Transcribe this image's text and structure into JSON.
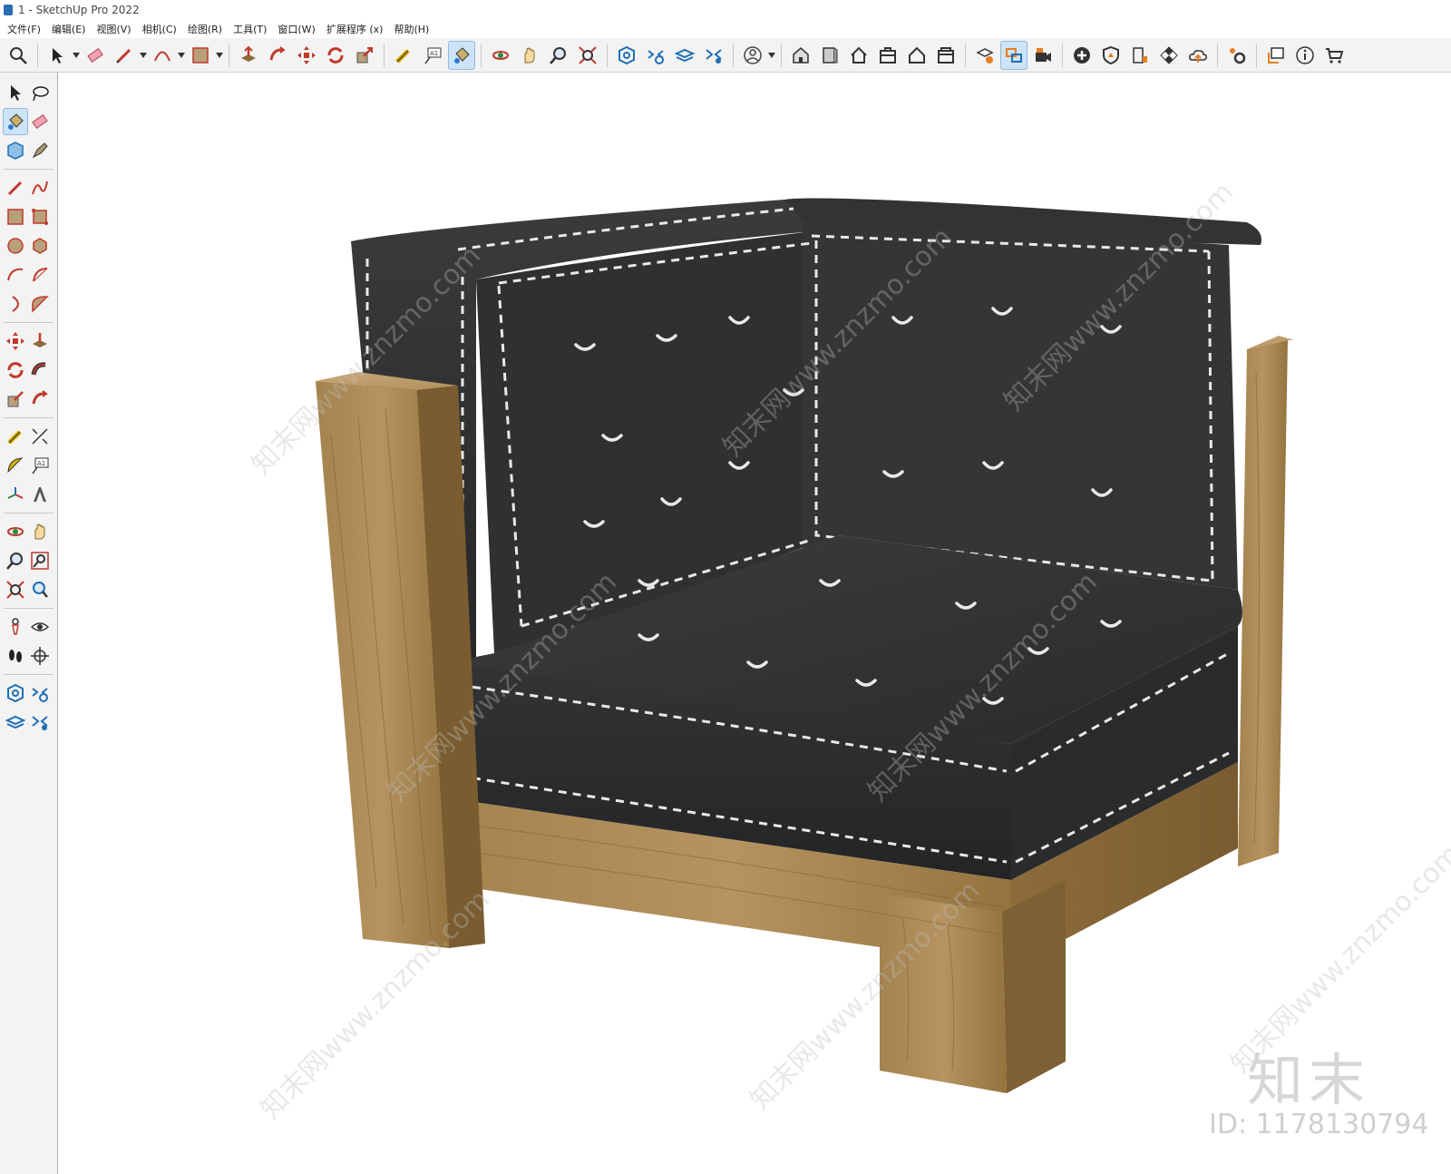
{
  "window": {
    "title": "1 - SketchUp Pro 2022"
  },
  "menu": [
    {
      "id": "file",
      "label": "文件(F)"
    },
    {
      "id": "edit",
      "label": "编辑(E)"
    },
    {
      "id": "view",
      "label": "视图(V)"
    },
    {
      "id": "camera",
      "label": "相机(C)"
    },
    {
      "id": "draw",
      "label": "绘图(R)"
    },
    {
      "id": "tools",
      "label": "工具(T)"
    },
    {
      "id": "window",
      "label": "窗口(W)"
    },
    {
      "id": "extensions",
      "label": "扩展程序 (x)"
    },
    {
      "id": "help",
      "label": "帮助(H)"
    }
  ],
  "toolbar": {
    "icons": [
      "search-icon",
      "select-arrow-icon",
      "eraser-icon",
      "pencil-icon",
      "arc-icon",
      "rectangle-icon",
      "push-pull-icon",
      "follow-me-icon",
      "move-icon",
      "rotate-icon",
      "scale-icon",
      "tape-measure-icon",
      "text-icon",
      "paint-bucket-icon",
      "orbit-icon",
      "pan-icon",
      "zoom-icon",
      "zoom-extents-icon",
      "component-icon",
      "styles-icon",
      "layers-icon",
      "scenes-icon",
      "profile-icon",
      "iso-view-icon",
      "front-view-icon",
      "home-icon",
      "top-view-icon",
      "house-outline-icon",
      "right-view-icon",
      "section-icon",
      "outliner-icon",
      "camera-export-icon",
      "plus-circle-icon",
      "shield-icon",
      "chart-icon",
      "checker-icon",
      "cloud-icon",
      "settings-icon",
      "popup-icon",
      "info-icon",
      "cart-icon"
    ]
  },
  "sidebar": {
    "icons": [
      "select-icon",
      "lasso-icon",
      "paint-icon",
      "eraser-icon",
      "component-icon",
      "tag-icon",
      "pencil-icon",
      "freehand-icon",
      "rectangle-icon",
      "rotated-rect-icon",
      "circle-icon",
      "polygon-icon",
      "arc-icon",
      "pie-icon",
      "arc2-icon",
      "arc3-icon",
      "move-icon",
      "push-pull-icon",
      "rotate-icon",
      "follow-me-icon",
      "scale-icon",
      "offset-icon",
      "tape-icon",
      "dimension-icon",
      "protractor-icon",
      "text-icon",
      "axes-icon",
      "3d-text-icon",
      "orbit-icon",
      "pan-icon",
      "zoom-icon",
      "zoom-window-icon",
      "zoom-extents-icon",
      "previous-view-icon",
      "position-camera-icon",
      "look-around-icon",
      "walk-icon",
      "section-plane-icon",
      "component-options-icon",
      "styles-icon",
      "layers-icon",
      "scenes-icon"
    ]
  },
  "watermark": {
    "brand": "知末",
    "id_text": "ID: 1178130794",
    "diagonal_text": "知末网www.znzmo.com"
  },
  "colors": {
    "wood": "#9b7a4a",
    "fabric": "#2e2f31",
    "stitch": "#e9e9e9",
    "selected": "#cde3f7"
  }
}
